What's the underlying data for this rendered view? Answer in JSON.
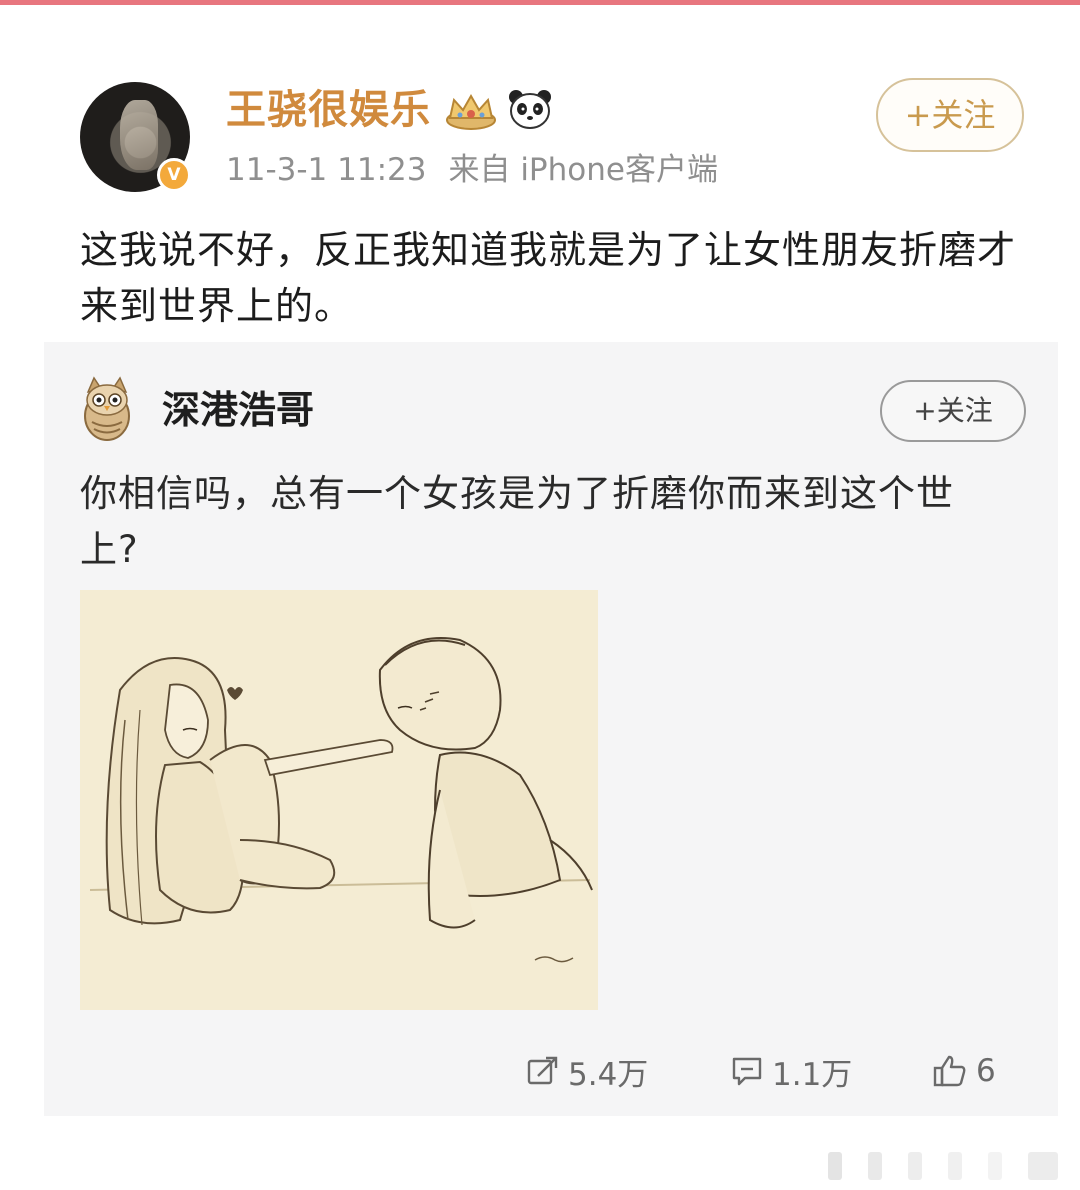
{
  "post": {
    "username": "王骁很娱乐",
    "verified_badge": "V",
    "timestamp": "11-3-1 11:23",
    "source": "来自 iPhone客户端",
    "follow_label": "+关注",
    "text": "这我说不好，反正我知道我就是为了让女性朋友折磨才来到世界上的。",
    "badges": [
      "crown-icon",
      "panda-icon"
    ]
  },
  "retweet": {
    "username": "深港浩哥",
    "follow_label": "+关注",
    "text": "你相信吗，总有一个女孩是为了折磨你而来到这个世上?",
    "image_description_icon": "sketch-image"
  },
  "stats": {
    "repost_count": "5.4万",
    "comment_count": "1.1万",
    "like_count": "6"
  },
  "colors": {
    "username": "#d08a3d",
    "follow_border": "#d6c29a",
    "card_bg": "#f5f5f6",
    "top_strip": "#e8767f"
  }
}
